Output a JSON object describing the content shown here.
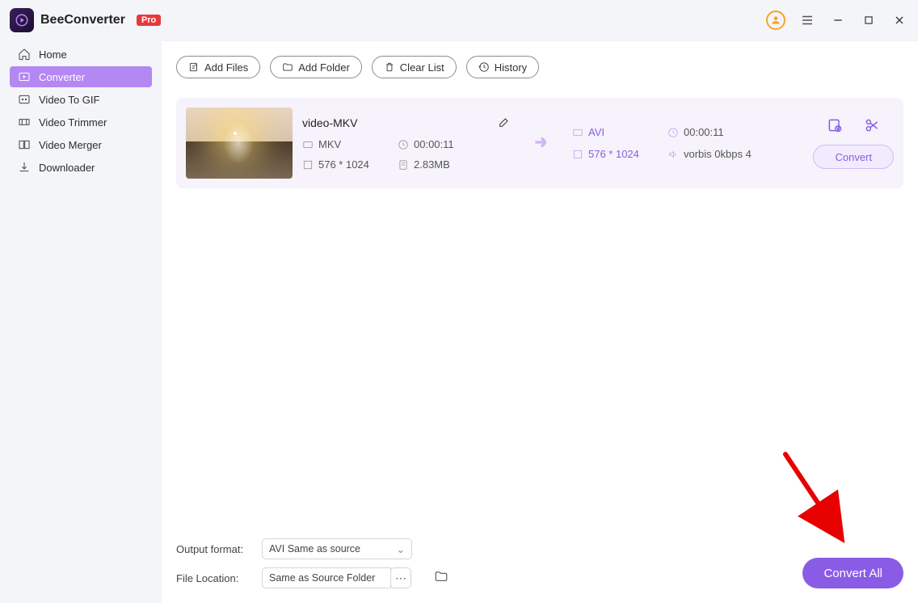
{
  "app": {
    "title": "BeeConverter",
    "badge": "Pro"
  },
  "sidebar": {
    "items": [
      {
        "label": "Home"
      },
      {
        "label": "Converter"
      },
      {
        "label": "Video To GIF"
      },
      {
        "label": "Video Trimmer"
      },
      {
        "label": "Video Merger"
      },
      {
        "label": "Downloader"
      }
    ]
  },
  "toolbar": {
    "add_files": "Add Files",
    "add_folder": "Add Folder",
    "clear_list": "Clear List",
    "history": "History"
  },
  "item": {
    "name": "video-MKV",
    "src": {
      "format": "MKV",
      "duration": "00:00:11",
      "dims": "576 * 1024",
      "size": "2.83MB"
    },
    "dst": {
      "format": "AVI",
      "duration": "00:00:11",
      "dims": "576 * 1024",
      "audio": "vorbis 0kbps 4"
    },
    "convert_label": "Convert"
  },
  "output": {
    "label": "Output format:",
    "value": "AVI Same as source"
  },
  "location": {
    "label": "File Location:",
    "value": "Same as Source Folder"
  },
  "convert_all": "Convert All"
}
